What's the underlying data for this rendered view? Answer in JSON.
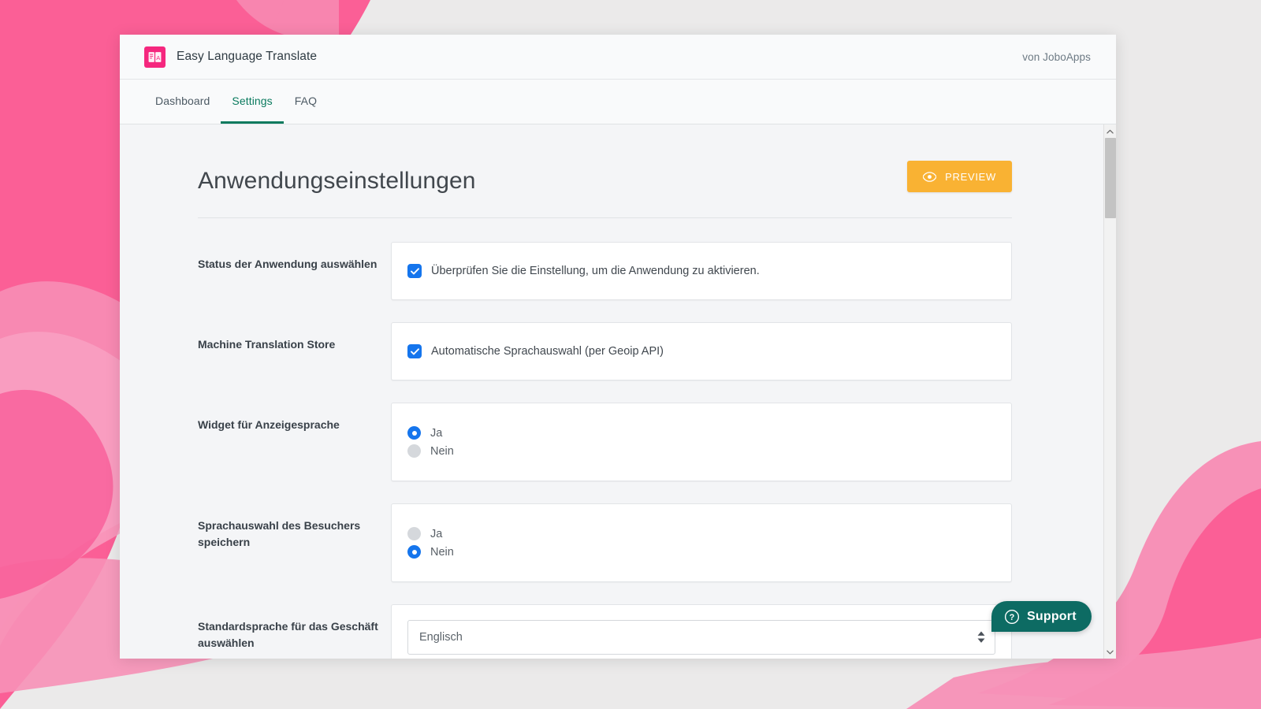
{
  "window": {
    "brand_title": "Easy Language Translate",
    "vendor": "von JoboApps",
    "logo_icon": "translate-book-icon",
    "logo_color": "#f5277e"
  },
  "nav": {
    "tabs": [
      {
        "label": "Dashboard",
        "active": false
      },
      {
        "label": "Settings",
        "active": true
      },
      {
        "label": "FAQ",
        "active": false
      }
    ],
    "active_color": "#0a7a5e"
  },
  "page": {
    "title": "Anwendungseinstellungen",
    "preview_button": {
      "label": "PREVIEW",
      "icon": "eye-icon",
      "color": "#f9b233"
    }
  },
  "form": {
    "rows": [
      {
        "label": "Status der Anwendung auswählen",
        "control": "checkbox",
        "checkbox_label": "Überprüfen Sie die Einstellung, um die Anwendung zu aktivieren.",
        "checked": true
      },
      {
        "label": "Machine Translation Store",
        "control": "checkbox",
        "checkbox_label": "Automatische Sprachauswahl (per Geoip API)",
        "checked": true
      },
      {
        "label": "Widget für Anzeigesprache",
        "control": "radio",
        "options": [
          {
            "label": "Ja",
            "selected": true
          },
          {
            "label": "Nein",
            "selected": false
          }
        ]
      },
      {
        "label": "Sprachauswahl des Besuchers speichern",
        "control": "radio",
        "options": [
          {
            "label": "Ja",
            "selected": false
          },
          {
            "label": "Nein",
            "selected": true
          }
        ]
      },
      {
        "label": "Standardsprache für das Geschäft auswählen",
        "control": "select",
        "value": "Englisch"
      }
    ],
    "checkbox_color": "#1575ed",
    "radio_on_color": "#1575ed",
    "radio_off_color": "#d5d8dc"
  },
  "support": {
    "label": "Support",
    "icon": "question-circle-icon",
    "color": "#0d6b63"
  },
  "scrollbar": {
    "up_icon": "chevron-up-icon",
    "down_icon": "chevron-down-icon"
  },
  "background": {
    "base_color": "#ebeaea",
    "wave_strong": "#fb5f96",
    "wave_soft": "#f98bb4",
    "wave_deep": "#fa3f86"
  }
}
